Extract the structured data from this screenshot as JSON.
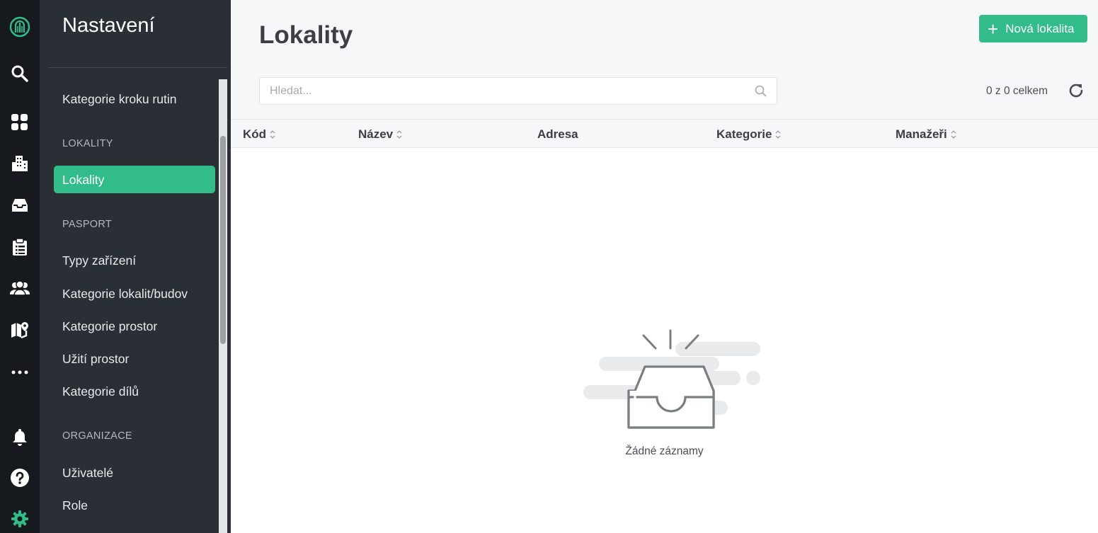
{
  "rail": {
    "items": [
      {
        "icon": "logo-icon"
      },
      {
        "icon": "search-icon"
      },
      {
        "icon": "dashboard-icon"
      },
      {
        "icon": "buildings-icon"
      },
      {
        "icon": "inbox-icon"
      },
      {
        "icon": "clipboard-icon"
      },
      {
        "icon": "users-icon"
      },
      {
        "icon": "map-icon"
      },
      {
        "icon": "more-icon"
      },
      {
        "icon": "bell-icon"
      },
      {
        "icon": "help-icon"
      },
      {
        "icon": "settings-icon"
      }
    ],
    "accent": "#31bc89"
  },
  "sidebar": {
    "title": "Nastavení",
    "items": [
      {
        "type": "item",
        "label": "Kategorie kroku rutin"
      },
      {
        "type": "section",
        "label": "LOKALITY"
      },
      {
        "type": "item",
        "label": "Lokality",
        "active": true
      },
      {
        "type": "section",
        "label": "PASPORT"
      },
      {
        "type": "item",
        "label": "Typy zařízení"
      },
      {
        "type": "item",
        "label": "Kategorie lokalit/budov"
      },
      {
        "type": "item",
        "label": "Kategorie prostor"
      },
      {
        "type": "item",
        "label": "Užití prostor"
      },
      {
        "type": "item",
        "label": "Kategorie dílů"
      },
      {
        "type": "section",
        "label": "ORGANIZACE"
      },
      {
        "type": "item",
        "label": "Uživatelé"
      },
      {
        "type": "item",
        "label": "Role"
      }
    ]
  },
  "main": {
    "title": "Lokality",
    "new_button": "Nová lokalita",
    "search_placeholder": "Hledat...",
    "count_text": "0 z 0 celkem",
    "columns": [
      {
        "label": "Kód",
        "sortable": true
      },
      {
        "label": "Název",
        "sortable": true
      },
      {
        "label": "Adresa",
        "sortable": false
      },
      {
        "label": "Kategorie",
        "sortable": true
      },
      {
        "label": "Manažeři",
        "sortable": true
      }
    ],
    "empty_text": "Žádné záznamy"
  },
  "colors": {
    "primary": "#31bc89",
    "rail_bg": "#16191d",
    "sidebar_bg": "#2a2e35"
  }
}
